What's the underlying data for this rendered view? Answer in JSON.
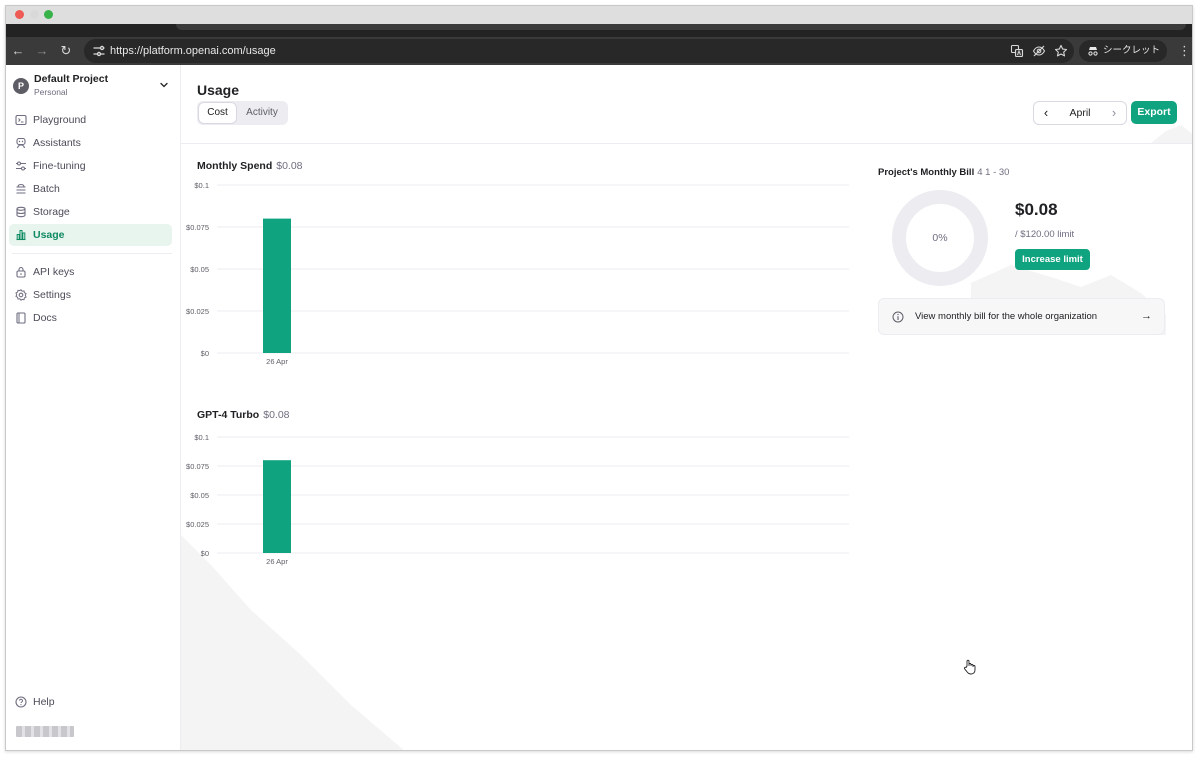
{
  "browser": {
    "url": "https://platform.openai.com/usage",
    "incognito_label": "シークレット"
  },
  "sidebar": {
    "project": {
      "avatar_letter": "P",
      "name": "Default Project",
      "subtitle": "Personal"
    },
    "items": [
      {
        "label": "Playground",
        "icon": "playground-icon"
      },
      {
        "label": "Assistants",
        "icon": "assistant-icon"
      },
      {
        "label": "Fine-tuning",
        "icon": "sliders-icon"
      },
      {
        "label": "Batch",
        "icon": "stack-icon"
      },
      {
        "label": "Storage",
        "icon": "database-icon"
      },
      {
        "label": "Usage",
        "icon": "bar-chart-icon",
        "active": true
      }
    ],
    "secondary_items": [
      {
        "label": "API keys",
        "icon": "lock-icon"
      },
      {
        "label": "Settings",
        "icon": "gear-icon"
      },
      {
        "label": "Docs",
        "icon": "book-icon"
      }
    ],
    "help_label": "Help"
  },
  "header": {
    "title": "Usage",
    "tabs": [
      {
        "label": "Cost",
        "selected": true
      },
      {
        "label": "Activity",
        "selected": false
      }
    ],
    "month": "April",
    "export_label": "Export"
  },
  "charts": {
    "monthly": {
      "title": "Monthly Spend",
      "total": "$0.08"
    },
    "gpt4": {
      "title": "GPT-4 Turbo",
      "total": "$0.08"
    }
  },
  "chart_data": [
    {
      "type": "bar",
      "title": "Monthly Spend $0.08",
      "categories": [
        "26 Apr"
      ],
      "values": [
        0.08
      ],
      "ylim": [
        0,
        0.1
      ],
      "yticks": [
        "$0.1",
        "$0.075",
        "$0.05",
        "$0.025",
        "$0"
      ],
      "color": "#10a37f",
      "grid": true
    },
    {
      "type": "bar",
      "title": "GPT-4 Turbo $0.08",
      "categories": [
        "26 Apr"
      ],
      "values": [
        0.08
      ],
      "ylim": [
        0,
        0.1
      ],
      "yticks": [
        "$0.1",
        "$0.075",
        "$0.05",
        "$0.025",
        "$0"
      ],
      "color": "#10a37f",
      "grid": true
    }
  ],
  "bill": {
    "title": "Project's Monthly Bill",
    "range": "4 1 - 30",
    "percent": "0%",
    "percent_value": 0,
    "amount": "$0.08",
    "limit": "/ $120.00 limit",
    "increase_label": "Increase limit",
    "org_link": "View monthly bill for the whole organization"
  },
  "colors": {
    "accent": "#10a37f",
    "active_bg": "#e8f4ee"
  }
}
